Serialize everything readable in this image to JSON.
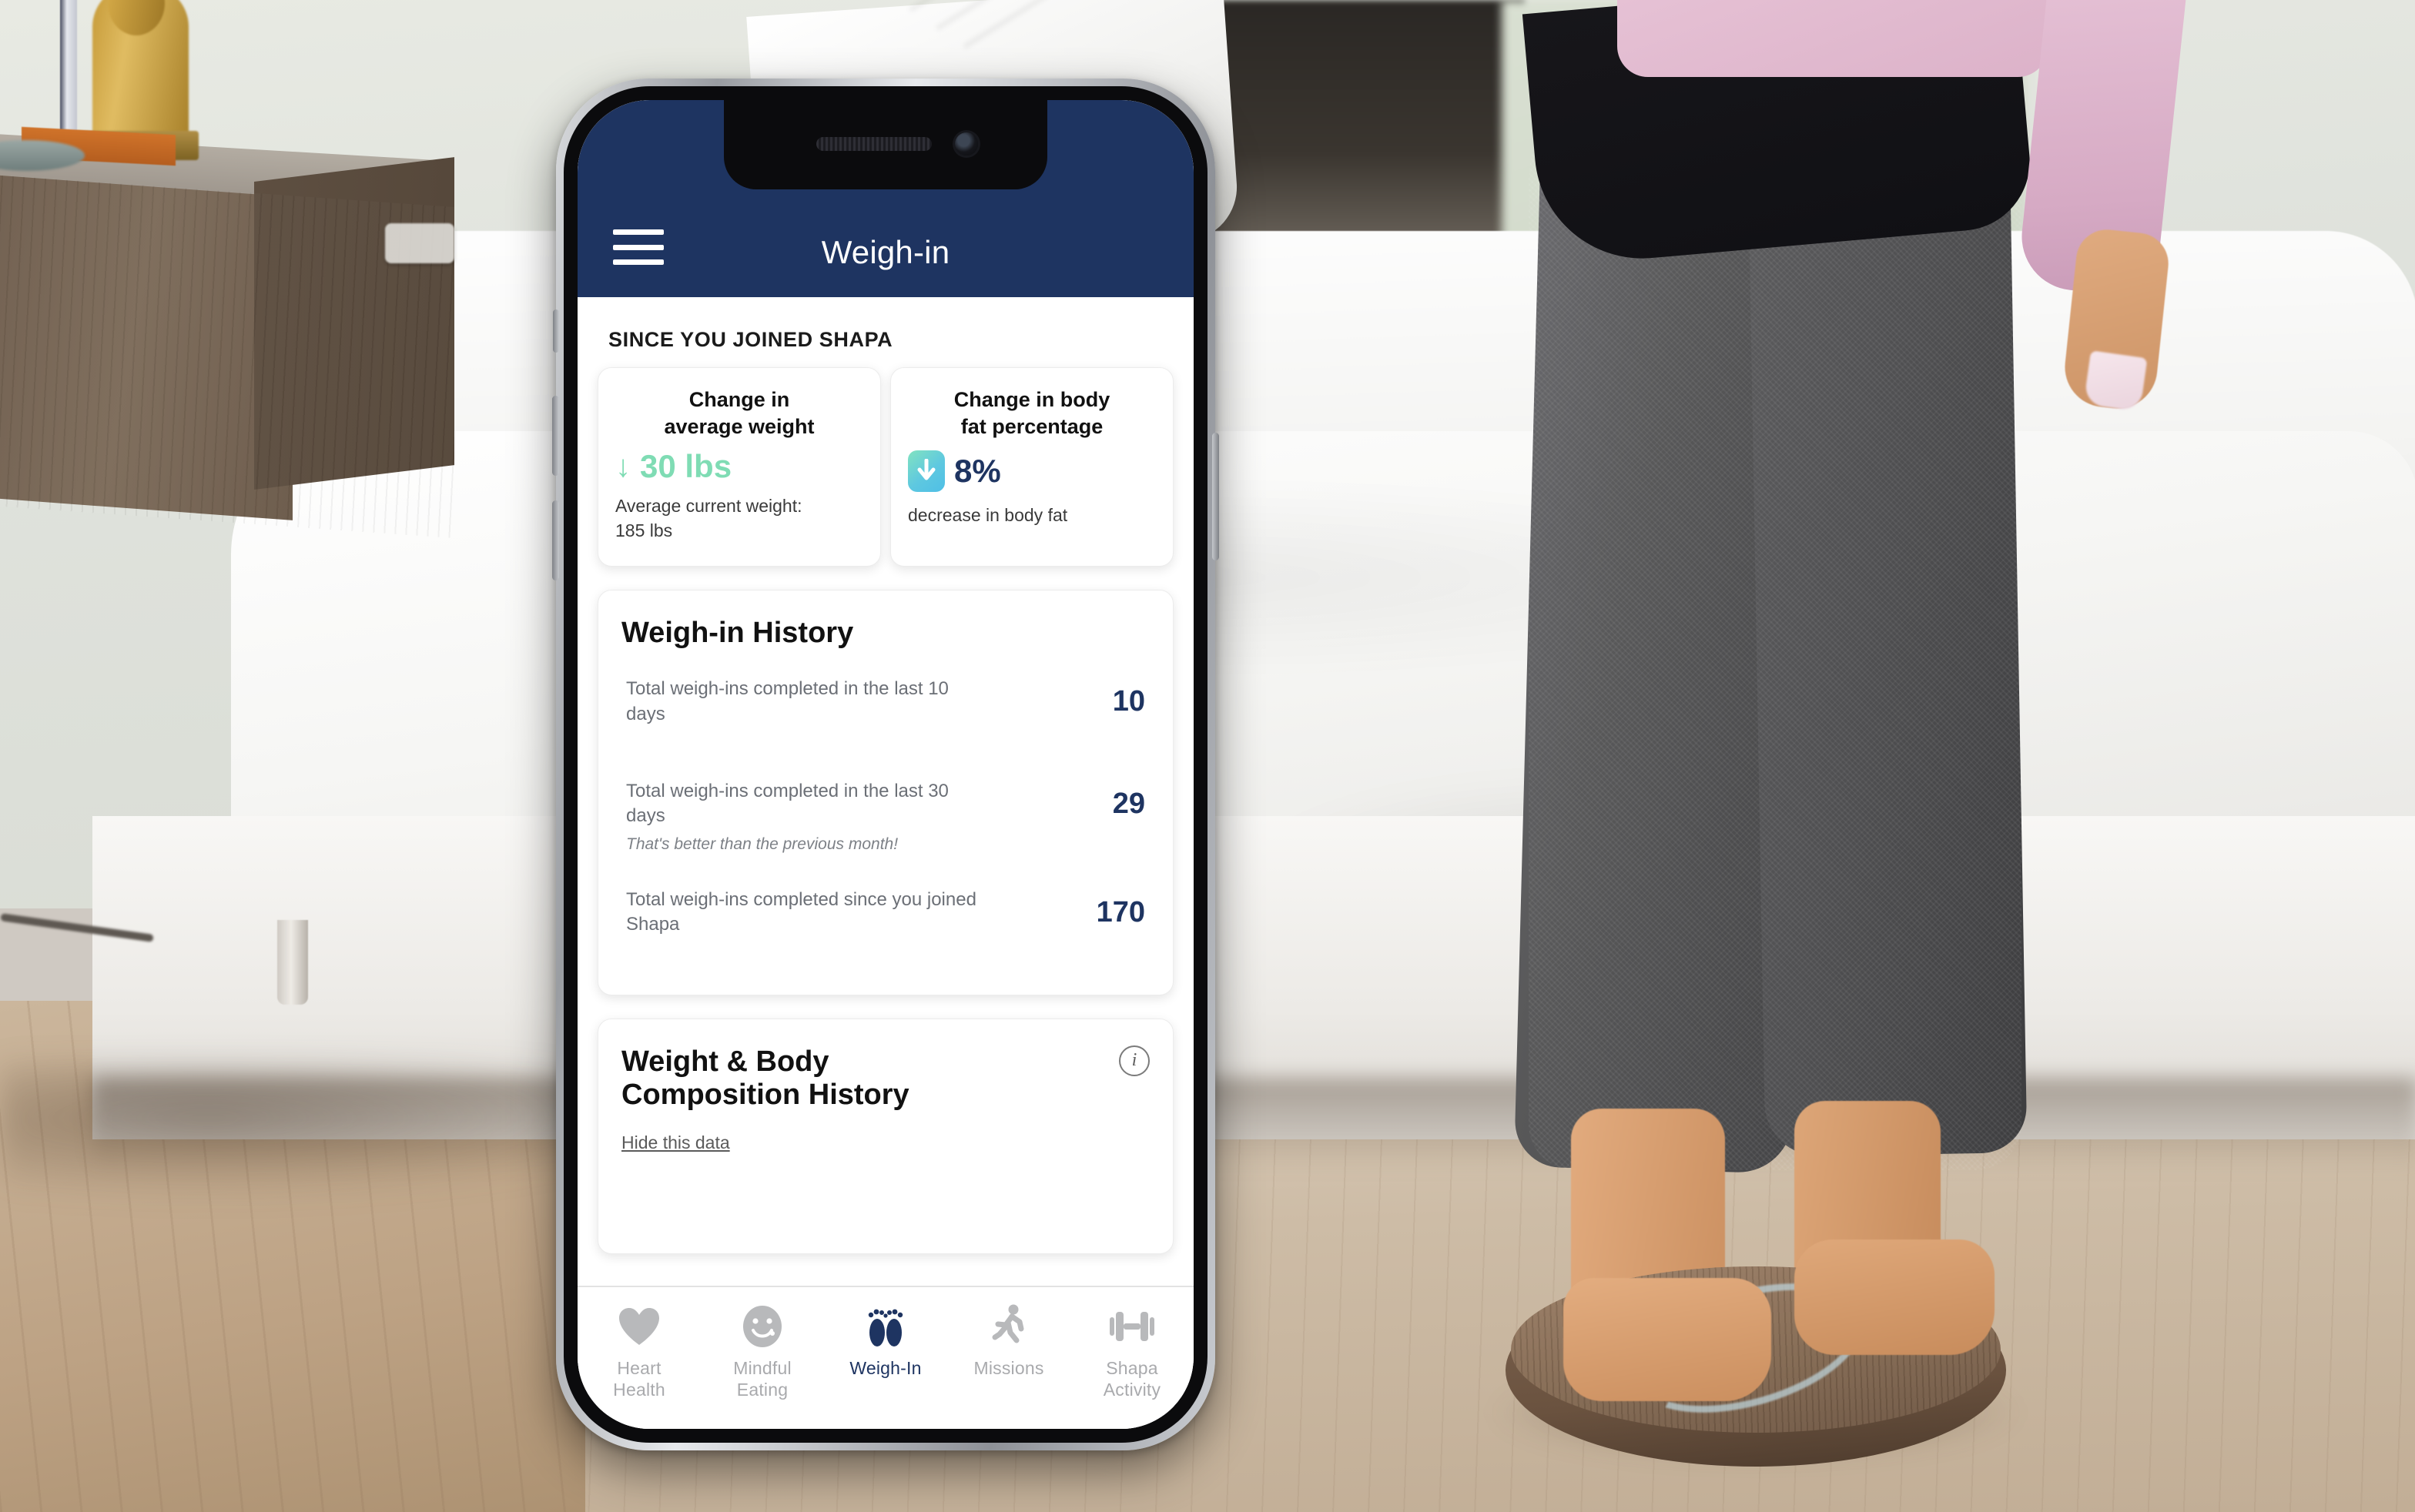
{
  "background": {
    "description": "Bedroom scene photo: woman standing on a round wooden smart scale beside a white bed, wood nightstand with gold buddha statue at left, light wood floor"
  },
  "device": {
    "type": "smartphone",
    "buttons": [
      "silent-switch",
      "volume-up",
      "volume-down",
      "power"
    ]
  },
  "app": {
    "header": {
      "title": "Weigh-in",
      "menu_icon": "hamburger-menu-icon",
      "bg_color": "#1e3461"
    },
    "section_label": "SINCE YOU JOINED SHAPA",
    "stat_cards": [
      {
        "title": "Change in\naverage weight",
        "title_line1": "Change in",
        "title_line2": "average weight",
        "icon": "arrow-down-icon",
        "value": "30 lbs",
        "value_color": "#7fdcb4",
        "sub_line1": "Average current weight:",
        "sub_line2": "185 lbs"
      },
      {
        "title_line1": "Change in body",
        "title_line2": "fat percentage",
        "icon": "arrow-down-filled-icon",
        "value": "8%",
        "value_color": "#1e3461",
        "sub_line1": "decrease in body fat",
        "sub_line2": ""
      }
    ],
    "history_card": {
      "title": "Weigh-in History",
      "rows": [
        {
          "label": "Total weigh-ins completed in the last 10 days",
          "value": "10",
          "note": ""
        },
        {
          "label": "Total weigh-ins completed in the last 30 days",
          "value": "29",
          "note": "That's better than the previous month!"
        },
        {
          "label": "Total weigh-ins completed since you joined Shapa",
          "value": "170",
          "note": ""
        }
      ]
    },
    "composition_card": {
      "title_line1": "Weight & Body",
      "title_line2": "Composition History",
      "info_icon": "info-circle-icon",
      "hide_link": "Hide this data"
    },
    "tabbar": {
      "items": [
        {
          "icon": "heart-icon",
          "line1": "Heart",
          "line2": "Health",
          "active": false
        },
        {
          "icon": "smiley-icon",
          "line1": "Mindful",
          "line2": "Eating",
          "active": false
        },
        {
          "icon": "footprints-icon",
          "line1": "Weigh-In",
          "line2": "",
          "active": true
        },
        {
          "icon": "running-icon",
          "line1": "Missions",
          "line2": "",
          "active": false
        },
        {
          "icon": "dumbbell-icon",
          "line1": "Shapa",
          "line2": "Activity",
          "active": false
        }
      ],
      "active_color": "#1e3461",
      "inactive_color": "#a9aaad"
    }
  }
}
